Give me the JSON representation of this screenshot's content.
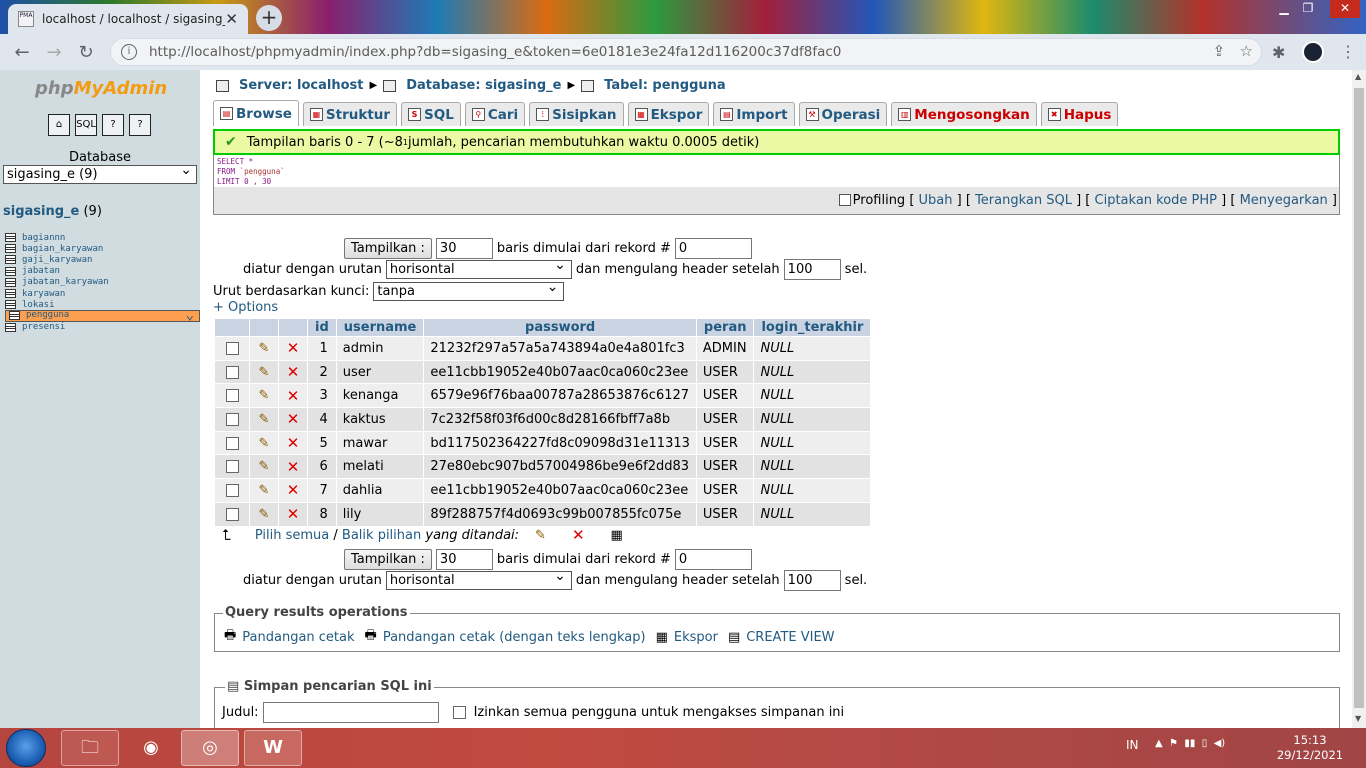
{
  "browser": {
    "tab_title": "localhost / localhost / sigasing_e",
    "favicon_text": "PMA",
    "url": "http://localhost/phpmyadmin/index.php?db=sigasing_e&token=6e0181e3e24fa12d116200c37df8fac0"
  },
  "sidebar": {
    "database_label": "Database",
    "db_select": "sigasing_e (9)",
    "db_name": "sigasing_e",
    "db_count": "(9)",
    "tables": [
      "bagiannn",
      "bagian_karyawan",
      "gaji_karyawan",
      "jabatan",
      "jabatan_karyawan",
      "karyawan",
      "lokasi",
      "pengguna",
      "presensi"
    ]
  },
  "breadcrumb": {
    "server": "Server: localhost",
    "database": "Database: sigasing_e",
    "table": "Tabel: pengguna"
  },
  "tabs": [
    "Browse",
    "Struktur",
    "SQL",
    "Cari",
    "Sisipkan",
    "Ekspor",
    "Import",
    "Operasi",
    "Mengosongkan",
    "Hapus"
  ],
  "notice": {
    "pre": "Tampilan baris 0 - 7 (~8",
    "sup": "1",
    "post": " jumlah, pencarian membutuhkan waktu 0.0005 detik)"
  },
  "sql": {
    "line1": "SELECT *",
    "line2a": "FROM ",
    "line2b": "`pengguna`",
    "line3": "LIMIT 0 , 30"
  },
  "sql_links": {
    "profiling": "Profiling",
    "ubah": "Ubah",
    "terangkan": "Terangkan SQL",
    "ciptakan": "Ciptakan kode PHP",
    "menyegarkan": "Menyegarkan"
  },
  "nav": {
    "tampilkan": "Tampilkan :",
    "rows": "30",
    "mulai": "baris dimulai dari rekord #",
    "start": "0",
    "diatur": "diatur dengan urutan",
    "mode": "horisontal",
    "mengulang": "dan mengulang header setelah",
    "repeat": "100",
    "sel": "sel.",
    "urut": "Urut berdasarkan kunci:",
    "kunci": "tanpa",
    "options": "+ Options"
  },
  "columns": [
    "id",
    "username",
    "password",
    "peran",
    "login_terakhir"
  ],
  "rows": [
    [
      "1",
      "admin",
      "21232f297a57a5a743894a0e4a801fc3",
      "ADMIN",
      "NULL"
    ],
    [
      "2",
      "user",
      "ee11cbb19052e40b07aac0ca060c23ee",
      "USER",
      "NULL"
    ],
    [
      "3",
      "kenanga",
      "6579e96f76baa00787a28653876c6127",
      "USER",
      "NULL"
    ],
    [
      "4",
      "kaktus",
      "7c232f58f03f6d00c8d28166fbff7a8b",
      "USER",
      "NULL"
    ],
    [
      "5",
      "mawar",
      "bd117502364227fd8c09098d31e11313",
      "USER",
      "NULL"
    ],
    [
      "6",
      "melati",
      "27e80ebc907bd57004986be9e6f2dd83",
      "USER",
      "NULL"
    ],
    [
      "7",
      "dahlia",
      "ee11cbb19052e40b07aac0ca060c23ee",
      "USER",
      "NULL"
    ],
    [
      "8",
      "lily",
      "89f288757f4d0693c99b007855fc075e",
      "USER",
      "NULL"
    ]
  ],
  "bulk": {
    "pilih": "Pilih semua",
    "sep": " / ",
    "balik": "Balik pilihan",
    "ditandai": "yang ditandai:"
  },
  "qro": {
    "legend": "Query results operations",
    "cetak": "Pandangan cetak",
    "cetak_lengkap": "Pandangan cetak (dengan teks lengkap)",
    "ekspor": "Ekspor",
    "view": "CREATE VIEW"
  },
  "simpan": {
    "legend": "Simpan pencarian SQL ini",
    "judul": "Judul:",
    "izinkan": "Izinkan semua pengguna untuk mengakses simpanan ini"
  },
  "taskbar": {
    "lang": "IN",
    "time": "15:13",
    "date": "29/12/2021"
  }
}
